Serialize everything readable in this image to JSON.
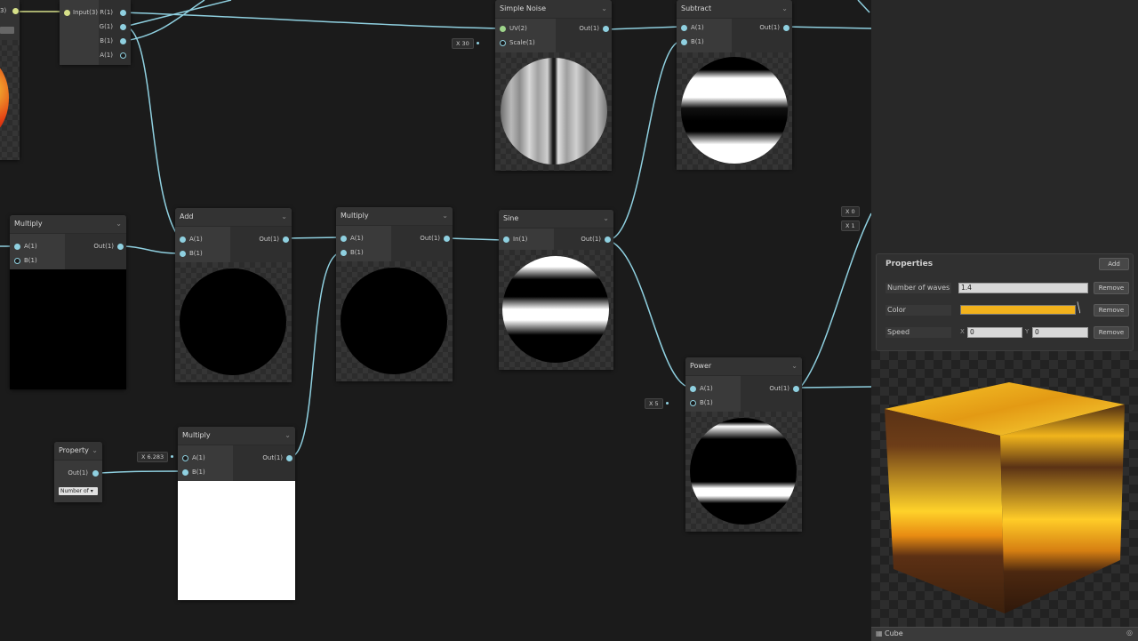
{
  "nodes": {
    "top_left_partial": {
      "label": "3)"
    },
    "split": {
      "input_label": "Input(3)",
      "outputs": [
        "R(1)",
        "G(1)",
        "B(1)",
        "A(1)"
      ]
    },
    "simple_noise": {
      "title": "Simple Noise",
      "inputs": [
        "UV(2)",
        "Scale(1)"
      ],
      "output": "Out(1)",
      "scale_value": "X 30"
    },
    "subtract": {
      "title": "Subtract",
      "inputs": [
        "A(1)",
        "B(1)"
      ],
      "output": "Out(1)"
    },
    "multiply_left": {
      "title": "Multiply",
      "inputs": [
        "A(1)",
        "B(1)"
      ],
      "output": "Out(1)"
    },
    "add": {
      "title": "Add",
      "inputs": [
        "A(1)",
        "B(1)"
      ],
      "output": "Out(1)"
    },
    "multiply_mid": {
      "title": "Multiply",
      "inputs": [
        "A(1)",
        "B(1)"
      ],
      "output": "Out(1)"
    },
    "sine": {
      "title": "Sine",
      "inputs": [
        "In(1)"
      ],
      "output": "Out(1)"
    },
    "power": {
      "title": "Power",
      "inputs": [
        "A(1)",
        "B(1)"
      ],
      "output": "Out(1)",
      "b_value": "X 5"
    },
    "property": {
      "title": "Property",
      "output": "Out(1)",
      "dropdown": "Number of"
    },
    "multiply_bottom": {
      "title": "Multiply",
      "inputs": [
        "A(1)",
        "B(1)"
      ],
      "output": "Out(1)",
      "a_value": "X 6.283"
    },
    "right_inputs": [
      "X 0",
      "X 1"
    ]
  },
  "properties": {
    "title": "Properties",
    "add_label": "Add",
    "remove_label": "Remove",
    "rows": [
      {
        "name": "Number of waves",
        "value": "1.4"
      },
      {
        "name": "Color",
        "color": "#f2b21c"
      },
      {
        "name": "Speed",
        "x_label": "X",
        "x": "0",
        "y_label": "Y",
        "y": "0"
      }
    ]
  },
  "preview": {
    "mesh_label": "Cube"
  },
  "colors": {
    "wire": "#8fd0e0",
    "wire_vec": "#d6e089",
    "accent": "#f2b21c"
  }
}
